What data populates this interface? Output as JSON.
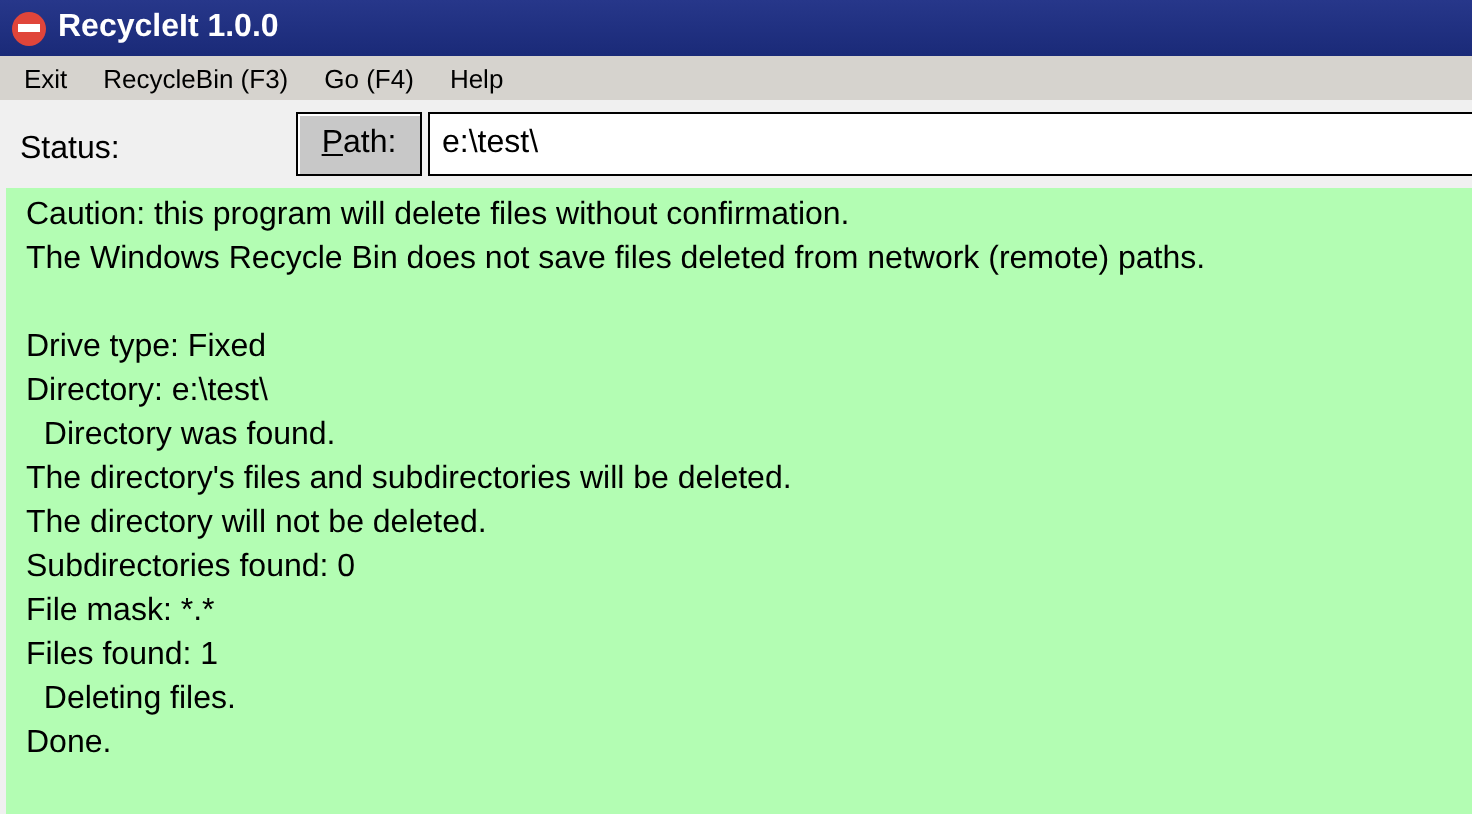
{
  "window": {
    "title": "RecycleIt 1.0.0"
  },
  "menu": [
    "Exit",
    "RecycleBin (F3)",
    "Go (F4)",
    "Help"
  ],
  "toolbar": {
    "status_label": "Status:",
    "path_button": {
      "mnemonic": "P",
      "rest": "ath:"
    },
    "path_field": {
      "value": "e:\\test\\"
    }
  },
  "log_blocks": [
    {
      "lines": [
        "Caution: this program will delete files without confirmation.",
        "The Windows Recycle Bin does not save files deleted from network (remote) paths."
      ]
    },
    {
      "lines": [
        "Drive type: Fixed",
        "Directory: e:\\test\\",
        "  Directory was found.",
        "The directory's files and subdirectories will be deleted.",
        "The directory will not be deleted.",
        "Subdirectories found: 0",
        "File mask: *.*",
        "Files found: 1",
        "  Deleting files.",
        "Done."
      ]
    }
  ]
}
